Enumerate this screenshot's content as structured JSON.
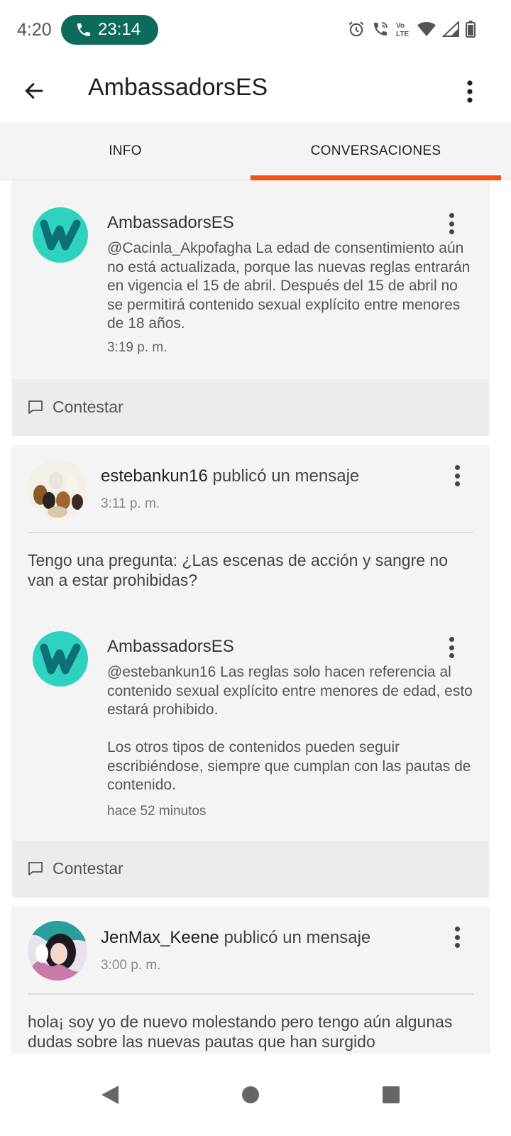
{
  "status_bar": {
    "time": "4:20",
    "call_timer": "23:14",
    "icons": [
      "alarm-icon",
      "wifi-call-icon",
      "volte-icon",
      "wifi-icon",
      "signal-icon",
      "battery-icon"
    ]
  },
  "app_bar": {
    "title": "AmbassadorsES",
    "back_icon": "arrow-left-icon",
    "more_icon": "more-vertical-icon"
  },
  "tabs": [
    {
      "label": "INFO",
      "active": false
    },
    {
      "label": "CONVERSACIONES",
      "active": true
    }
  ],
  "colors": {
    "accent": "#f2510e",
    "call_pill": "#0c6b5a",
    "wattpad_logo": "#2ed3bf"
  },
  "conversations": [
    {
      "reply": {
        "author": "AmbassadorsES",
        "text": "@Cacinla_Akpofagha La edad de consentimiento aún no está actualizada, porque las nuevas reglas entrarán en vigencia el 15 de abril. Después del 15 de abril no se permitirá contenido sexual explícito entre menores de 18 años.",
        "time": "3:19 p. m."
      },
      "reply_action": "Contestar"
    },
    {
      "poster": "estebankun16",
      "action": "publicó un mensaje",
      "time": "3:11 p. m.",
      "body": "Tengo una pregunta: ¿Las escenas de acción y sangre no van a estar prohibidas?",
      "reply": {
        "author": "AmbassadorsES",
        "text_1": "@estebankun16 Las reglas solo hacen referencia al contenido sexual explícito entre menores de edad, esto estará prohibido.",
        "text_2": "Los otros tipos de contenidos pueden seguir escribiéndose, siempre que cumplan con las pautas de contenido.",
        "time": "hace 52 minutos"
      },
      "reply_action": "Contestar"
    },
    {
      "poster": "JenMax_Keene",
      "action": "publicó un mensaje",
      "time": "3:00 p. m.",
      "body": "hola¡ soy yo de nuevo molestando pero tengo aún algunas dudas sobre las nuevas pautas que han surgido"
    }
  ],
  "nav_bar": {
    "icons": [
      "nav-back-icon",
      "nav-home-icon",
      "nav-recents-icon"
    ]
  }
}
